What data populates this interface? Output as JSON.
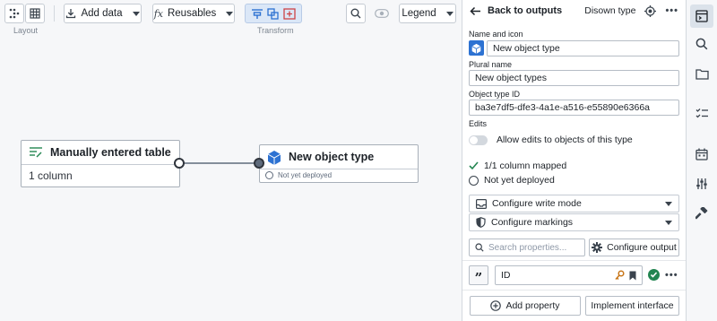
{
  "toolbar": {
    "layout_label": "Layout",
    "add_data_label": "Add data",
    "reusables_label": "Reusables",
    "transform_label": "Transform",
    "legend_label": "Legend"
  },
  "graph": {
    "source_node": {
      "title": "Manually entered table",
      "detail": "1 column"
    },
    "target_node": {
      "title": "New object type",
      "status": "Not yet deployed"
    }
  },
  "panel": {
    "back_label": "Back to outputs",
    "owner_type": "Disown type",
    "name_icon_label": "Name and icon",
    "name_value": "New object type",
    "plural_label": "Plural name",
    "plural_value": "New object types",
    "id_label": "Object type ID",
    "id_value": "ba3e7df5-dfe3-4a1e-a516-e55890e6366a",
    "edits_label": "Edits",
    "edits_toggle_label": "Allow edits to objects of this type",
    "mapped_status": "1/1 column mapped",
    "deploy_status": "Not yet deployed",
    "write_mode_label": "Configure write mode",
    "markings_label": "Configure markings",
    "search_placeholder": "Search properties...",
    "configure_output_label": "Configure output",
    "property_name": "ID",
    "add_property_label": "Add property",
    "implement_interface_label": "Implement interface"
  },
  "colors": {
    "accent": "#2d72d2",
    "success": "#238551",
    "key": "#c87619",
    "text": "#1c2127"
  },
  "icons": {
    "rail": [
      "layout-icon",
      "search-icon",
      "folder-icon",
      "checklist-icon",
      "calendar-icon",
      "sliders-icon",
      "build-icon"
    ]
  }
}
